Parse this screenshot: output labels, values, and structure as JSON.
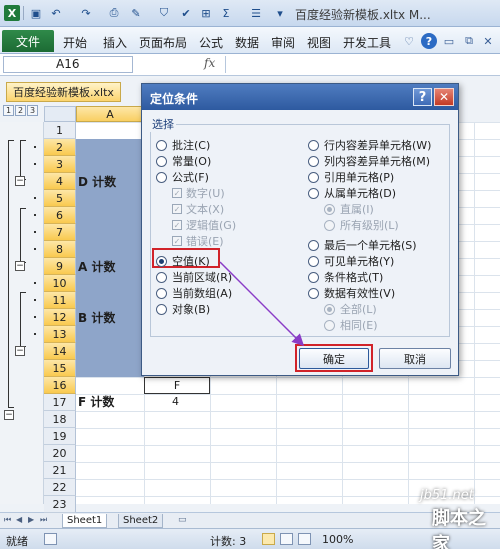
{
  "window": {
    "title": "百度经验新模板.xltx M...",
    "minimize": "─",
    "maximize": "□",
    "close": "✕"
  },
  "qat": {
    "logo": "X",
    "icons": [
      "save-icon",
      "undo-icon",
      "redo-icon",
      "print-preview-icon",
      "format-painter-icon",
      "filter-icon",
      "borders-icon",
      "autosum-icon",
      "align-icon",
      "dropdown-icon"
    ]
  },
  "ribbon": {
    "file": "文件",
    "tabs": [
      "开始",
      "插入",
      "页面布局",
      "公式",
      "数据",
      "审阅",
      "视图",
      "开发工具"
    ],
    "help": "?"
  },
  "formula_bar": {
    "name_box": "A16",
    "fx": "fx",
    "content": ""
  },
  "workbook": {
    "tab": "百度经验新模板.xltx",
    "outline_levels": [
      "1",
      "2",
      "3"
    ],
    "columns": [
      "A"
    ],
    "rows": [
      "1",
      "2",
      "3",
      "4",
      "5",
      "6",
      "7",
      "8",
      "9",
      "10",
      "11",
      "12",
      "13",
      "14",
      "15",
      "16",
      "17",
      "18",
      "19",
      "20",
      "21",
      "22",
      "23"
    ],
    "cells": {
      "d_count": "D 计数",
      "a_count": "A 计数",
      "b_count": "B 计数",
      "f_count": "F 计数",
      "f_header": "F",
      "f_value": "4"
    }
  },
  "sheets": {
    "tabs": [
      "Sheet1",
      "Sheet2"
    ]
  },
  "status": {
    "ready": "就绪",
    "count": "计数: 3",
    "zoom": "100%"
  },
  "dialog": {
    "title": "定位条件",
    "help": "?",
    "close": "✕",
    "group": "选择",
    "left": [
      {
        "label": "批注(C)",
        "type": "radio"
      },
      {
        "label": "常量(O)",
        "type": "radio"
      },
      {
        "label": "公式(F)",
        "type": "radio"
      },
      {
        "label": "数字(U)",
        "type": "check"
      },
      {
        "label": "文本(X)",
        "type": "check"
      },
      {
        "label": "逻辑值(G)",
        "type": "check"
      },
      {
        "label": "错误(E)",
        "type": "check"
      },
      {
        "label": "空值(K)",
        "type": "radio",
        "selected": true
      },
      {
        "label": "当前区域(R)",
        "type": "radio"
      },
      {
        "label": "当前数组(A)",
        "type": "radio"
      },
      {
        "label": "对象(B)",
        "type": "radio"
      }
    ],
    "right": [
      {
        "label": "行内容差异单元格(W)",
        "type": "radio"
      },
      {
        "label": "列内容差异单元格(M)",
        "type": "radio"
      },
      {
        "label": "引用单元格(P)",
        "type": "radio"
      },
      {
        "label": "从属单元格(D)",
        "type": "radio"
      },
      {
        "label": "直属(I)",
        "type": "subradio"
      },
      {
        "label": "所有级别(L)",
        "type": "subradio"
      },
      {
        "label": "最后一个单元格(S)",
        "type": "radio"
      },
      {
        "label": "可见单元格(Y)",
        "type": "radio"
      },
      {
        "label": "条件格式(T)",
        "type": "radio"
      },
      {
        "label": "数据有效性(V)",
        "type": "radio"
      },
      {
        "label": "全部(L)",
        "type": "subradio"
      },
      {
        "label": "相同(E)",
        "type": "subradio"
      }
    ],
    "ok": "确定",
    "cancel": "取消"
  },
  "watermark": {
    "site": "jb51.net",
    "name": "脚本之家"
  },
  "colors": {
    "accent": "#2e5aa0",
    "highlight": "#d1232a",
    "arrow": "#8a3cc7",
    "selection": "#8ea5c9",
    "header_selected": "#f9cf63"
  }
}
